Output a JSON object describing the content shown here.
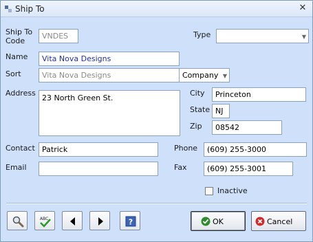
{
  "window": {
    "title": "Ship To",
    "close_glyph": "✕"
  },
  "fields": {
    "ship_to_code_label": "Ship To\nCode",
    "ship_to_code_value": "VNDES",
    "type_label": "Type",
    "type_value": "",
    "name_label": "Name",
    "name_value": "Vita Nova Designs",
    "sort_label": "Sort",
    "sort_value": "Vita Nova Designs",
    "sort_type_value": "Company",
    "address_label": "Address",
    "address_value": "23 North Green St.",
    "city_label": "City",
    "city_value": "Princeton",
    "state_label": "State",
    "state_value": "NJ",
    "zip_label": "Zip",
    "zip_value": "08542",
    "contact_label": "Contact",
    "contact_value": "Patrick",
    "phone_label": "Phone",
    "phone_value": "(609) 255-3000",
    "email_label": "Email",
    "email_value": "",
    "fax_label": "Fax",
    "fax_value": "(609) 255-3001",
    "inactive_label": "Inactive",
    "inactive_checked": false
  },
  "buttons": {
    "search_icon": "magnifier-icon",
    "spellcheck_icon": "spellcheck-icon",
    "prev_icon": "left-arrow-icon",
    "next_icon": "right-arrow-icon",
    "help_icon": "help-icon",
    "ok_label": "OK",
    "cancel_label": "Cancel"
  },
  "colors": {
    "background": "#cfe0fa",
    "name_text": "#1b2fa8",
    "ok_icon": "#2e8b2e",
    "cancel_icon": "#d02a2a"
  }
}
